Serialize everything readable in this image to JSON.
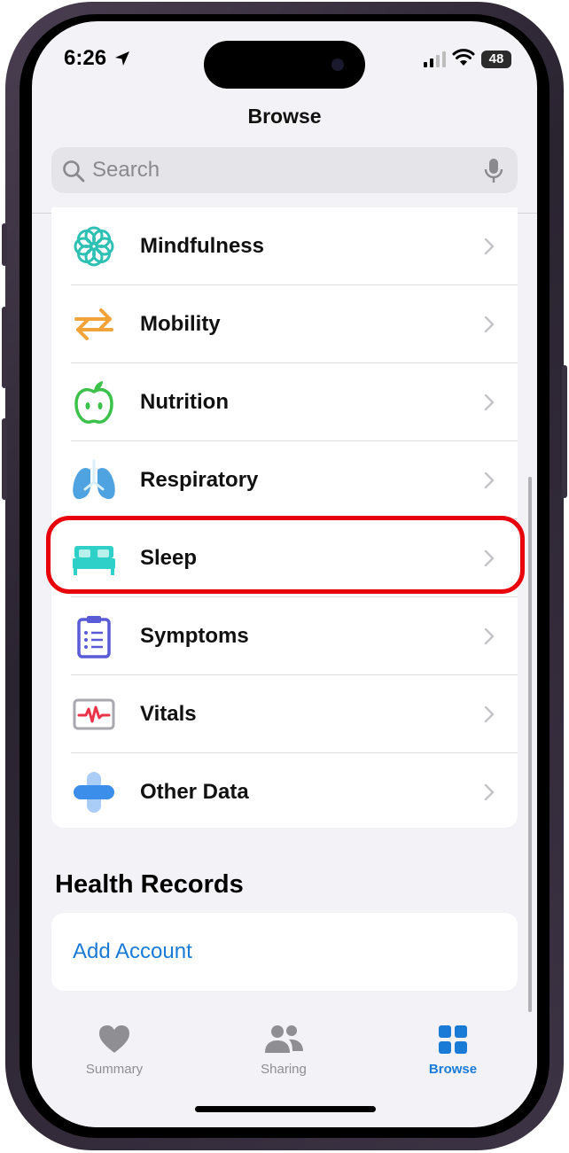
{
  "status_bar": {
    "time": "6:26",
    "battery": "48"
  },
  "header": {
    "title": "Browse"
  },
  "search": {
    "placeholder": "Search"
  },
  "categories": [
    {
      "label": "Mindfulness",
      "icon": "mindfulness-flower-icon",
      "color": "#2fc0b4"
    },
    {
      "label": "Mobility",
      "icon": "mobility-arrows-icon",
      "color": "#f2a33a"
    },
    {
      "label": "Nutrition",
      "icon": "nutrition-apple-icon",
      "color": "#3cc24a"
    },
    {
      "label": "Respiratory",
      "icon": "respiratory-lungs-icon",
      "color": "#4fa3e0"
    },
    {
      "label": "Sleep",
      "icon": "sleep-bed-icon",
      "color": "#2fd0c8"
    },
    {
      "label": "Symptoms",
      "icon": "symptoms-clipboard-icon",
      "color": "#5a5bd6"
    },
    {
      "label": "Vitals",
      "icon": "vitals-monitor-icon",
      "color": "#e8334a"
    },
    {
      "label": "Other Data",
      "icon": "other-data-plus-icon",
      "color": "#3b8eea"
    }
  ],
  "health_records": {
    "title": "Health Records",
    "add_account": "Add Account"
  },
  "tab_bar": {
    "tabs": [
      {
        "label": "Summary",
        "icon": "heart-icon",
        "active": false
      },
      {
        "label": "Sharing",
        "icon": "people-icon",
        "active": false
      },
      {
        "label": "Browse",
        "icon": "grid-icon",
        "active": true
      }
    ]
  },
  "colors": {
    "accent": "#1a7bd6",
    "highlight": "#e8000a",
    "inactive": "#8e8e93"
  }
}
